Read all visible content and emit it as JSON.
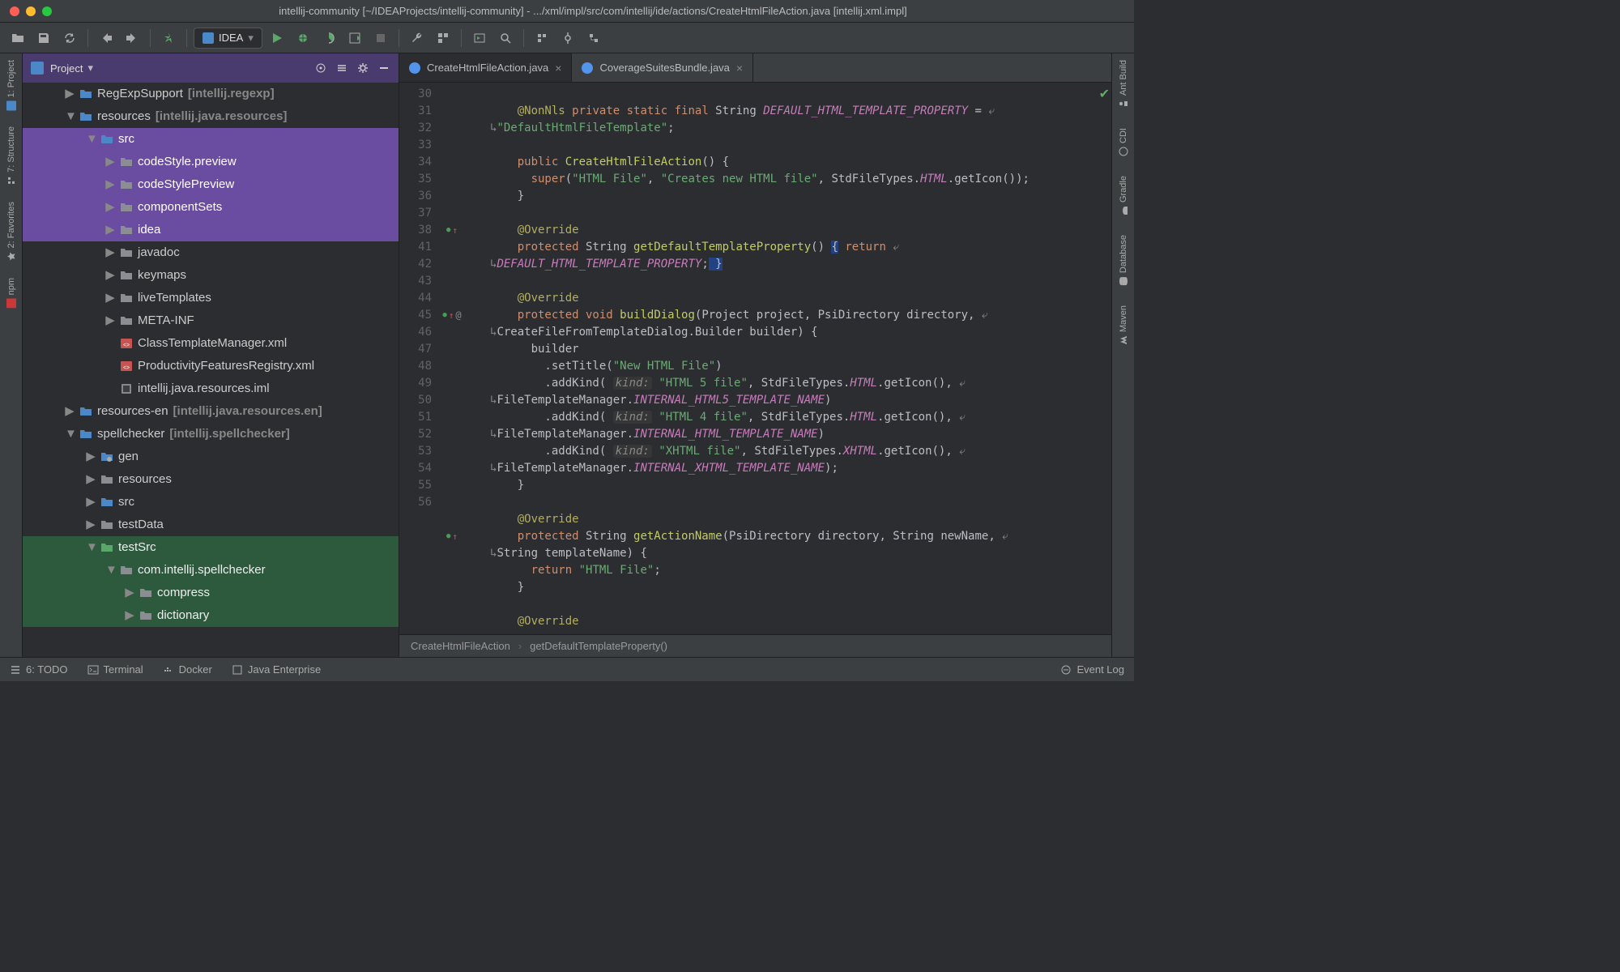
{
  "window": {
    "title": "intellij-community [~/IDEAProjects/intellij-community] - .../xml/impl/src/com/intellij/ide/actions/CreateHtmlFileAction.java [intellij.xml.impl]"
  },
  "runconfig": {
    "name": "IDEA"
  },
  "leftTools": [
    {
      "label": "1: Project"
    },
    {
      "label": "7: Structure"
    },
    {
      "label": "2: Favorites"
    },
    {
      "label": "npm"
    }
  ],
  "rightTools": [
    {
      "label": "Ant Build"
    },
    {
      "label": "CDI"
    },
    {
      "label": "Gradle"
    },
    {
      "label": "Database"
    },
    {
      "label": "Maven"
    }
  ],
  "projectPanel": {
    "title": "Project"
  },
  "tree": [
    {
      "indent": 1,
      "arrow": "▶",
      "icon": "folder-blue",
      "label": "RegExpSupport",
      "bracket": "[intellij.regexp]"
    },
    {
      "indent": 1,
      "arrow": "▼",
      "icon": "folder-blue",
      "label": "resources",
      "bracket": "[intellij.java.resources]"
    },
    {
      "indent": 2,
      "arrow": "▼",
      "icon": "folder-blue",
      "label": "src",
      "sel": "purple"
    },
    {
      "indent": 3,
      "arrow": "▶",
      "icon": "folder-grey",
      "label": "codeStyle.preview",
      "sel": "purple"
    },
    {
      "indent": 3,
      "arrow": "▶",
      "icon": "folder-grey",
      "label": "codeStylePreview",
      "sel": "purple"
    },
    {
      "indent": 3,
      "arrow": "▶",
      "icon": "folder-grey",
      "label": "componentSets",
      "sel": "purple"
    },
    {
      "indent": 3,
      "arrow": "▶",
      "icon": "folder-grey",
      "label": "idea",
      "sel": "purple"
    },
    {
      "indent": 3,
      "arrow": "▶",
      "icon": "folder-grey",
      "label": "javadoc"
    },
    {
      "indent": 3,
      "arrow": "▶",
      "icon": "folder-grey",
      "label": "keymaps"
    },
    {
      "indent": 3,
      "arrow": "▶",
      "icon": "folder-grey",
      "label": "liveTemplates"
    },
    {
      "indent": 3,
      "arrow": "▶",
      "icon": "folder-grey",
      "label": "META-INF"
    },
    {
      "indent": 3,
      "arrow": "",
      "icon": "xml",
      "label": "ClassTemplateManager.xml"
    },
    {
      "indent": 3,
      "arrow": "",
      "icon": "xml",
      "label": "ProductivityFeaturesRegistry.xml"
    },
    {
      "indent": 3,
      "arrow": "",
      "icon": "iml",
      "label": "intellij.java.resources.iml"
    },
    {
      "indent": 1,
      "arrow": "▶",
      "icon": "folder-blue",
      "label": "resources-en",
      "bracket": "[intellij.java.resources.en]"
    },
    {
      "indent": 1,
      "arrow": "▼",
      "icon": "folder-blue",
      "label": "spellchecker",
      "bracket": "[intellij.spellchecker]"
    },
    {
      "indent": 2,
      "arrow": "▶",
      "icon": "folder-cfg",
      "label": "gen"
    },
    {
      "indent": 2,
      "arrow": "▶",
      "icon": "folder-grey",
      "label": "resources"
    },
    {
      "indent": 2,
      "arrow": "▶",
      "icon": "folder-blue",
      "label": "src"
    },
    {
      "indent": 2,
      "arrow": "▶",
      "icon": "folder-grey",
      "label": "testData"
    },
    {
      "indent": 2,
      "arrow": "▼",
      "icon": "folder-green",
      "label": "testSrc",
      "sel": "green"
    },
    {
      "indent": 3,
      "arrow": "▼",
      "icon": "folder-grey",
      "label": "com.intellij.spellchecker",
      "sel": "green"
    },
    {
      "indent": 4,
      "arrow": "▶",
      "icon": "folder-grey",
      "label": "compress",
      "sel": "green"
    },
    {
      "indent": 4,
      "arrow": "▶",
      "icon": "folder-grey",
      "label": "dictionary",
      "sel": "green"
    }
  ],
  "editorTabs": [
    {
      "label": "CreateHtmlFileAction.java",
      "icon": "#5394ec",
      "active": true
    },
    {
      "label": "CoverageSuitesBundle.java",
      "icon": "#5394ec",
      "active": false
    }
  ],
  "lineNumbers": [
    "30",
    "31",
    "",
    "32",
    "33",
    "34",
    "35",
    "36",
    "37",
    "38",
    "",
    "41",
    "42",
    "43",
    "",
    "44",
    "45",
    "46",
    "",
    "47",
    "",
    "48",
    "",
    "49",
    "50",
    "51",
    "52",
    "",
    "53",
    "54",
    "55",
    "56"
  ],
  "gutterMarks": {
    "8": "●↑",
    "13": "●↑ @",
    "26": "●↑"
  },
  "breadcrumbs": [
    "CreateHtmlFileAction",
    "getDefaultTemplateProperty()"
  ],
  "statusbar": {
    "todo": "6: TODO",
    "terminal": "Terminal",
    "docker": "Docker",
    "javaee": "Java Enterprise",
    "eventlog": "Event Log"
  }
}
